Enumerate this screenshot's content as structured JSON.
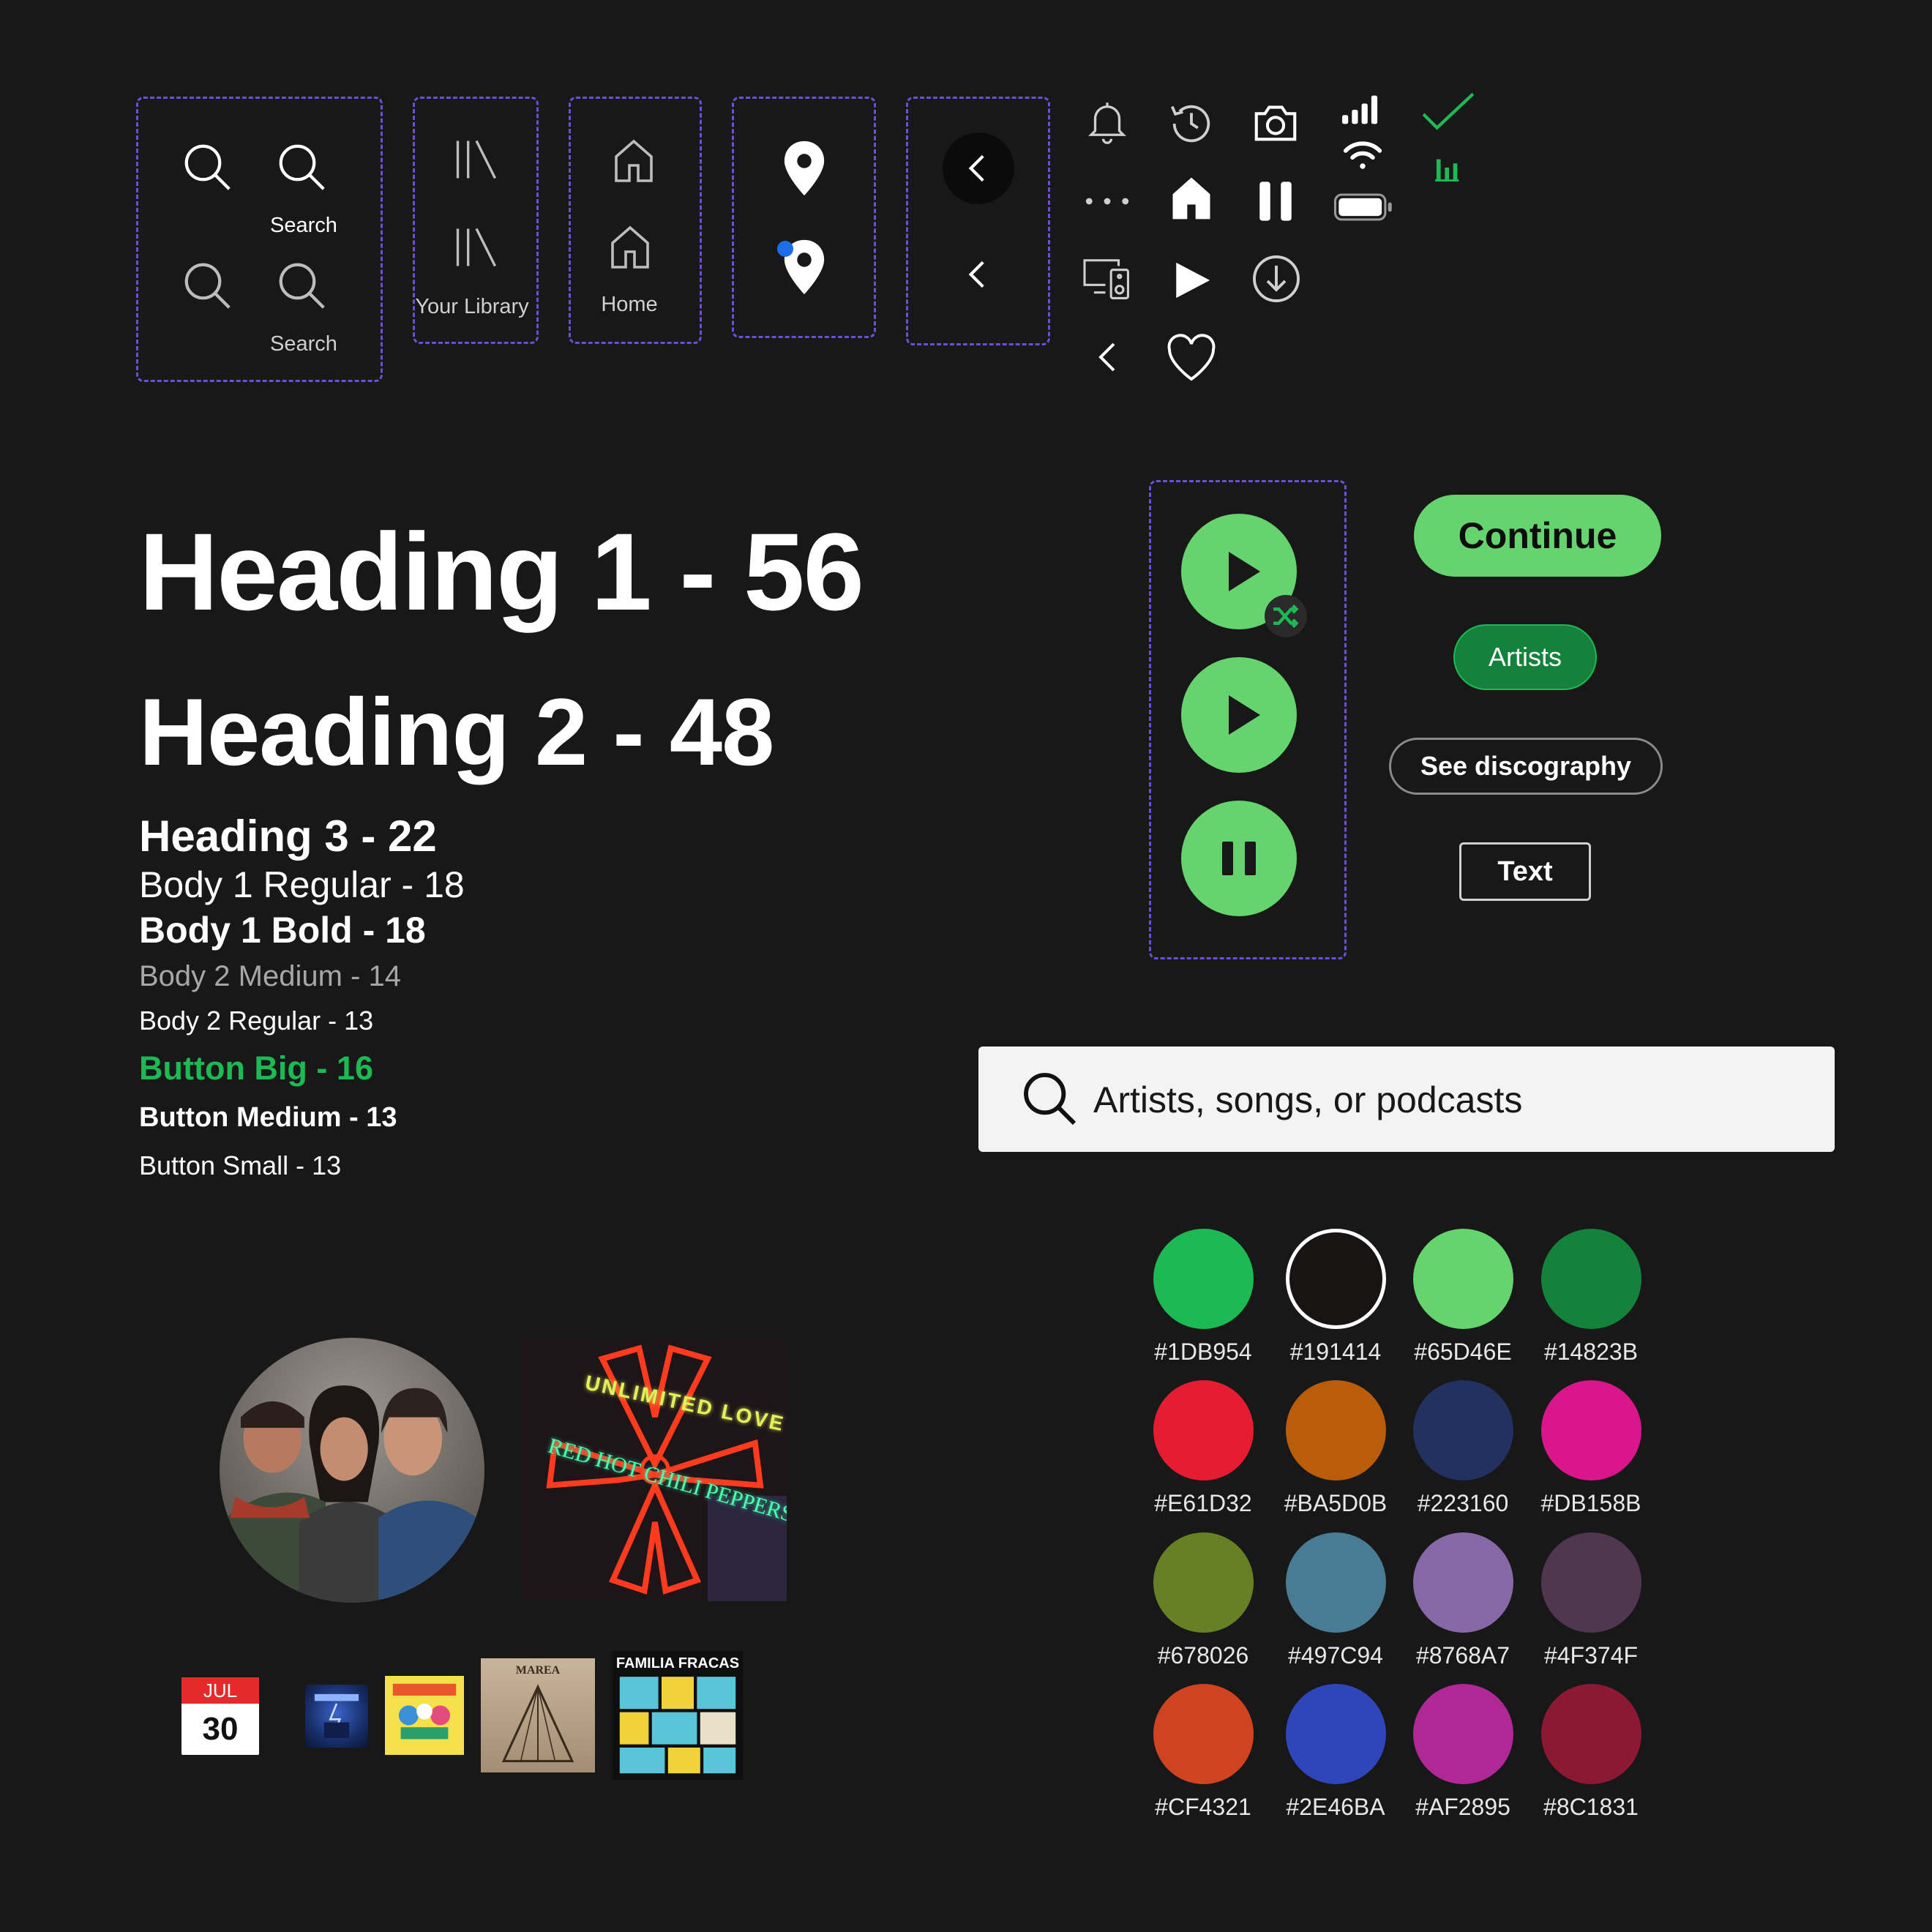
{
  "nav_icons": {
    "search_label_1": "Search",
    "search_label_2": "Search",
    "library_label": "Your Library",
    "home_label": "Home"
  },
  "typography": {
    "h1": "Heading 1 - 56",
    "h2": "Heading 2 - 48",
    "h3": "Heading 3 - 22",
    "body1_regular": "Body 1 Regular - 18",
    "body1_bold": "Body 1 Bold - 18",
    "body2_medium": "Body 2 Medium - 14",
    "body2_regular": "Body 2 Regular - 13",
    "button_big": "Button Big - 16",
    "button_medium": "Button Medium - 13",
    "button_small": "Button Small - 13"
  },
  "buttons": {
    "continue": "Continue",
    "artists": "Artists",
    "see_discography": "See discography",
    "text": "Text"
  },
  "search": {
    "placeholder": "Artists, songs, or podcasts"
  },
  "palette": [
    {
      "hex": "#1DB954",
      "color": "#1DB954"
    },
    {
      "hex": "#191414",
      "color": "#191414"
    },
    {
      "hex": "#65D46E",
      "color": "#65D46E"
    },
    {
      "hex": "#14823B",
      "color": "#14823B"
    },
    {
      "hex": "#E61D32",
      "color": "#E61D32"
    },
    {
      "hex": "#BA5D0B",
      "color": "#BA5D0B"
    },
    {
      "hex": "#223160",
      "color": "#223160"
    },
    {
      "hex": "#DB158B",
      "color": "#DB158B"
    },
    {
      "hex": "#678026",
      "color": "#678026"
    },
    {
      "hex": "#497C94",
      "color": "#497C94"
    },
    {
      "hex": "#8768A7",
      "color": "#8768A7"
    },
    {
      "hex": "#4F374F",
      "color": "#4F374F"
    },
    {
      "hex": "#CF4321",
      "color": "#CF4321"
    },
    {
      "hex": "#2E46BA",
      "color": "#2E46BA"
    },
    {
      "hex": "#AF2895",
      "color": "#AF2895"
    },
    {
      "hex": "#8C1831",
      "color": "#8C1831"
    }
  ],
  "media": {
    "calendar_month": "JUL",
    "calendar_day": "30",
    "album_cover_neon_text": "UNLIMITED LOVE",
    "album_cover_neon_band": "RED HOT CHILI PEPPERS",
    "thumb_marea_title": "MAREA",
    "thumb_familia_title": "FAMILIA FRACAS"
  },
  "colors": {
    "accent": "#1DB954",
    "accent_light": "#65D46E",
    "accent_dark": "#14823B",
    "background": "#181818",
    "guide_dash": "#6b50d6"
  }
}
